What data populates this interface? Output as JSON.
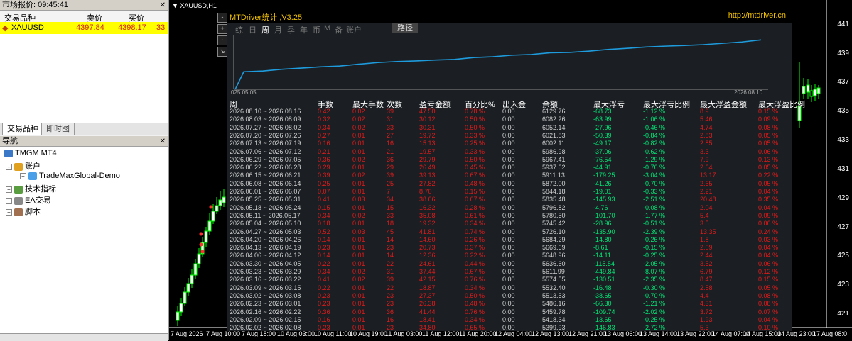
{
  "market_watch": {
    "title": "市场报价: 09:45:41",
    "col_symbol": "交易品种",
    "col_bid": "卖价",
    "col_ask": "买价",
    "row": {
      "symbol": "XAUUSD",
      "bid": "4397.84",
      "ask": "4398.17",
      "spread": "33"
    },
    "tabs": [
      "交易品种",
      "即时图"
    ]
  },
  "navigator": {
    "title": "导航",
    "root": "TMGM MT4",
    "items": [
      {
        "label": "账户",
        "indent": 1,
        "exp": "-",
        "icon_color": "#e0a020"
      },
      {
        "label": "TradeMaxGlobal-Demo",
        "indent": 2,
        "exp": "+",
        "icon_color": "#4aa0e8"
      },
      {
        "label": "技术指标",
        "indent": 1,
        "exp": "+",
        "icon_color": "#5a9c40"
      },
      {
        "label": "EA交易",
        "indent": 1,
        "exp": "+",
        "icon_color": "#888888"
      },
      {
        "label": "脚本",
        "indent": 1,
        "exp": "+",
        "icon_color": "#a07050"
      }
    ]
  },
  "chart": {
    "symbol_label": "XAUUSD,H1",
    "price_labels": [
      "441",
      "439",
      "437",
      "435",
      "433",
      "431",
      "429",
      "427",
      "425",
      "423",
      "421"
    ],
    "time_labels": [
      "7 Aug 2026",
      "7 Aug 10:00",
      "7 Aug 18:00",
      "10 Aug 03:00",
      "10 Aug 11:00",
      "10 Aug 19:00",
      "11 Aug 03:00",
      "11 Aug 12:00",
      "11 Aug 20:00",
      "12 Aug 04:00",
      "12 Aug 13:00",
      "12 Aug 21:00",
      "13 Aug 06:00",
      "13 Aug 14:00",
      "13 Aug 22:00",
      "14 Aug 07:00",
      "14 Aug 15:00",
      "14 Aug 23:00",
      "17 Aug 08:0"
    ],
    "side_buttons": [
      "-",
      "+",
      "-",
      "↘"
    ]
  },
  "panel": {
    "title": "MTDriver统计 ,V3.25",
    "url": "http://mtdriver.cn",
    "tabs": [
      "综",
      "日",
      "周",
      "月",
      "季",
      "年",
      "币",
      "M",
      "备",
      "账户"
    ],
    "selected_tab": "周",
    "route_button": "路径",
    "equity": {
      "start_label": "025.05.05",
      "end_label": "2026.08.10",
      "values": [
        6129.76,
        6082.26,
        6052.14,
        6021.83,
        6002.11,
        5986.98,
        5967.41,
        5937.62,
        5911.13,
        5872.0,
        5844.18,
        5835.48,
        5796.82,
        5780.5,
        5745.42,
        5726.1,
        5684.29,
        5669.69,
        5648.96,
        5636.6,
        5611.99,
        5574.55,
        5532.4,
        5513.53,
        5486.16,
        5459.78,
        5418.34,
        5399.93
      ]
    },
    "columns": [
      "周",
      "手数",
      "最大手数",
      "次数",
      "盈亏金额",
      "百分比%",
      "出入金",
      "余额",
      "最大浮亏",
      "最大浮亏比例",
      "最大浮盈金额",
      "最大浮盈比例"
    ],
    "rows": [
      [
        "2026.08.10 ~ 2026.08.16",
        "0.42",
        "0.02",
        "39",
        "47.50",
        "0.78 %",
        "0.00",
        "6129.76",
        "-68.73",
        "-1.12 %",
        "8.9",
        "0.15 %"
      ],
      [
        "2026.08.03 ~ 2026.08.09",
        "0.32",
        "0.02",
        "31",
        "30.12",
        "0.50 %",
        "0.00",
        "6082.26",
        "-63.99",
        "-1.06 %",
        "5.46",
        "0.09 %"
      ],
      [
        "2026.07.27 ~ 2026.08.02",
        "0.34",
        "0.02",
        "33",
        "30.31",
        "0.50 %",
        "0.00",
        "6052.14",
        "-27.96",
        "-0.46 %",
        "4.74",
        "0.08 %"
      ],
      [
        "2026.07.20 ~ 2026.07.26",
        "0.27",
        "0.01",
        "27",
        "19.72",
        "0.33 %",
        "0.00",
        "6021.83",
        "-50.39",
        "-0.84 %",
        "2.83",
        "0.05 %"
      ],
      [
        "2026.07.13 ~ 2026.07.19",
        "0.16",
        "0.01",
        "16",
        "15.13",
        "0.25 %",
        "0.00",
        "6002.11",
        "-49.17",
        "-0.82 %",
        "2.85",
        "0.05 %"
      ],
      [
        "2026.07.06 ~ 2026.07.12",
        "0.21",
        "0.01",
        "21",
        "19.57",
        "0.33 %",
        "0.00",
        "5986.98",
        "-37.06",
        "-0.62 %",
        "3.3",
        "0.06 %"
      ],
      [
        "2026.06.29 ~ 2026.07.05",
        "0.36",
        "0.02",
        "36",
        "29.79",
        "0.50 %",
        "0.00",
        "5967.41",
        "-76.54",
        "-1.29 %",
        "7.9",
        "0.13 %"
      ],
      [
        "2026.06.22 ~ 2026.06.28",
        "0.29",
        "0.01",
        "29",
        "26.49",
        "0.45 %",
        "0.00",
        "5937.62",
        "-44.91",
        "-0.76 %",
        "2.64",
        "0.05 %"
      ],
      [
        "2026.06.15 ~ 2026.06.21",
        "0.39",
        "0.02",
        "39",
        "39.13",
        "0.67 %",
        "0.00",
        "5911.13",
        "-179.25",
        "-3.04 %",
        "13.17",
        "0.22 %"
      ],
      [
        "2026.06.08 ~ 2026.06.14",
        "0.25",
        "0.01",
        "25",
        "27.82",
        "0.48 %",
        "0.00",
        "5872.00",
        "-41.26",
        "-0.70 %",
        "2.65",
        "0.05 %"
      ],
      [
        "2026.06.01 ~ 2026.06.07",
        "0.07",
        "0.01",
        "7",
        "8.70",
        "0.15 %",
        "0.00",
        "5844.18",
        "-19.01",
        "-0.33 %",
        "2.21",
        "0.04 %"
      ],
      [
        "2026.05.25 ~ 2026.05.31",
        "0.41",
        "0.03",
        "34",
        "38.66",
        "0.67 %",
        "0.00",
        "5835.48",
        "-145.93",
        "-2.51 %",
        "20.48",
        "0.35 %"
      ],
      [
        "2026.05.18 ~ 2026.05.24",
        "0.15",
        "0.01",
        "15",
        "16.32",
        "0.28 %",
        "0.00",
        "5796.82",
        "-4.76",
        "-0.08 %",
        "2.04",
        "0.04 %"
      ],
      [
        "2026.05.11 ~ 2026.05.17",
        "0.34",
        "0.02",
        "33",
        "35.08",
        "0.61 %",
        "0.00",
        "5780.50",
        "-101.70",
        "-1.77 %",
        "5.4",
        "0.09 %"
      ],
      [
        "2026.05.04 ~ 2026.05.10",
        "0.18",
        "0.01",
        "18",
        "19.32",
        "0.34 %",
        "0.00",
        "5745.42",
        "-28.96",
        "-0.51 %",
        "3.5",
        "0.06 %"
      ],
      [
        "2026.04.27 ~ 2026.05.03",
        "0.52",
        "0.03",
        "45",
        "41.81",
        "0.74 %",
        "0.00",
        "5726.10",
        "-135.90",
        "-2.39 %",
        "13.35",
        "0.24 %"
      ],
      [
        "2026.04.20 ~ 2026.04.26",
        "0.14",
        "0.01",
        "14",
        "14.60",
        "0.26 %",
        "0.00",
        "5684.29",
        "-14.80",
        "-0.26 %",
        "1.8",
        "0.03 %"
      ],
      [
        "2026.04.13 ~ 2026.04.19",
        "0.23",
        "0.01",
        "23",
        "20.73",
        "0.37 %",
        "0.00",
        "5669.69",
        "-8.61",
        "-0.15 %",
        "2.09",
        "0.04 %"
      ],
      [
        "2026.04.06 ~ 2026.04.12",
        "0.14",
        "0.01",
        "14",
        "12.36",
        "0.22 %",
        "0.00",
        "5648.96",
        "-14.11",
        "-0.25 %",
        "2.44",
        "0.04 %"
      ],
      [
        "2026.03.30 ~ 2026.04.05",
        "0.22",
        "0.01",
        "22",
        "24.61",
        "0.44 %",
        "0.00",
        "5636.60",
        "-115.54",
        "-2.05 %",
        "3.52",
        "0.06 %"
      ],
      [
        "2026.03.23 ~ 2026.03.29",
        "0.34",
        "0.02",
        "31",
        "37.44",
        "0.67 %",
        "0.00",
        "5611.99",
        "-449.84",
        "-8.07 %",
        "6.79",
        "0.12 %"
      ],
      [
        "2026.03.16 ~ 2026.03.22",
        "0.41",
        "0.02",
        "39",
        "42.15",
        "0.76 %",
        "0.00",
        "5574.55",
        "-130.51",
        "-2.35 %",
        "8.47",
        "0.15 %"
      ],
      [
        "2026.03.09 ~ 2026.03.15",
        "0.22",
        "0.01",
        "22",
        "18.87",
        "0.34 %",
        "0.00",
        "5532.40",
        "-16.48",
        "-0.30 %",
        "2.58",
        "0.05 %"
      ],
      [
        "2026.03.02 ~ 2026.03.08",
        "0.23",
        "0.01",
        "23",
        "27.37",
        "0.50 %",
        "0.00",
        "5513.53",
        "-38.65",
        "-0.70 %",
        "4.4",
        "0.08 %"
      ],
      [
        "2026.02.23 ~ 2026.03.01",
        "0.23",
        "0.01",
        "23",
        "26.38",
        "0.48 %",
        "0.00",
        "5486.16",
        "-66.30",
        "-1.21 %",
        "4.31",
        "0.08 %"
      ],
      [
        "2026.02.16 ~ 2026.02.22",
        "0.36",
        "0.01",
        "36",
        "41.44",
        "0.76 %",
        "0.00",
        "5459.78",
        "-109.74",
        "-2.02 %",
        "3.72",
        "0.07 %"
      ],
      [
        "2026.02.09 ~ 2026.02.15",
        "0.16",
        "0.01",
        "16",
        "18.41",
        "0.34 %",
        "0.00",
        "5418.34",
        "-13.65",
        "-0.25 %",
        "1.93",
        "0.04 %"
      ],
      [
        "2026.02.02 ~ 2026.02.08",
        "0.23",
        "0.01",
        "23",
        "34.80",
        "0.65 %",
        "0.00",
        "5399.93",
        "-146.83",
        "-2.72 %",
        "5.3",
        "0.10 %"
      ]
    ],
    "colors": {
      "loss": "#00e676",
      "gain": "#e01b1b",
      "neutral": "#cfcfcf",
      "accent": "#f0c000",
      "line": "#1e9bdc"
    }
  }
}
